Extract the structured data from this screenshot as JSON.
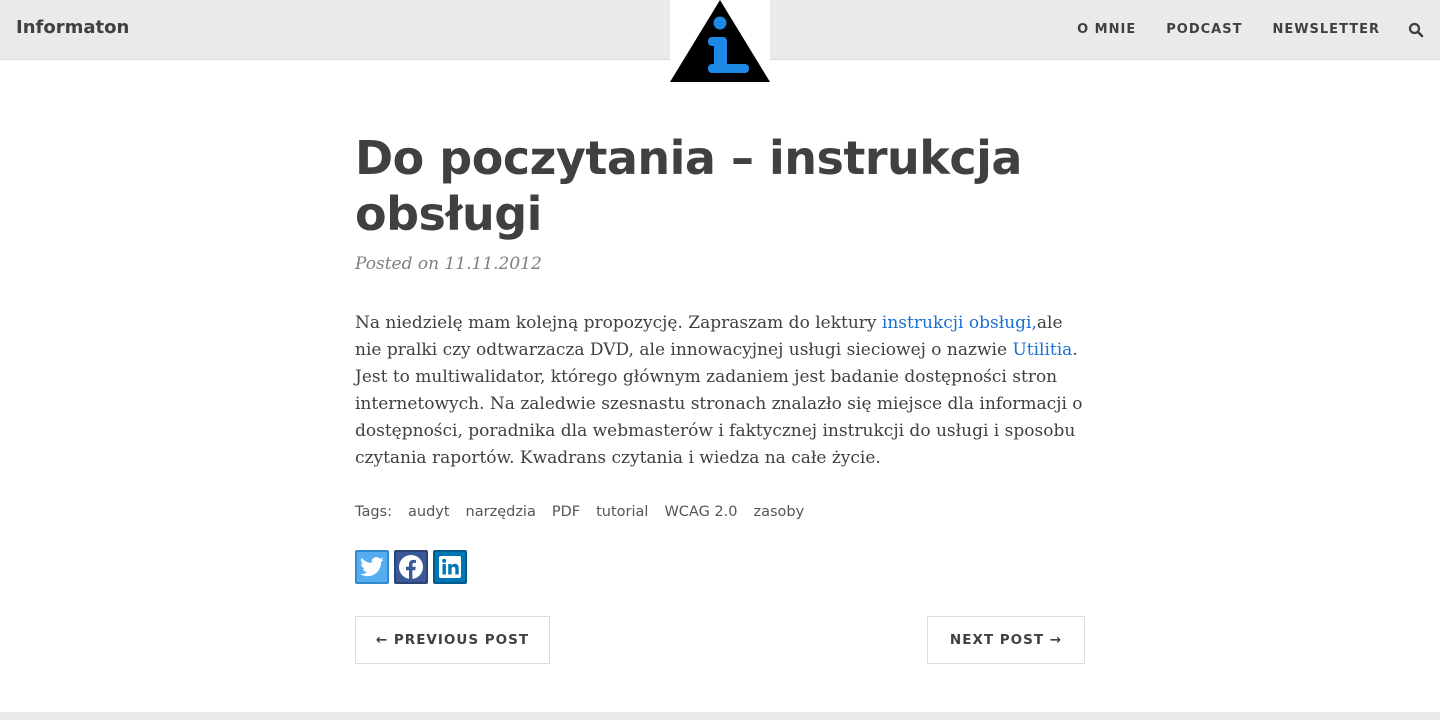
{
  "header": {
    "brand": "Informaton",
    "nav": [
      "O MNIE",
      "PODCAST",
      "NEWSLETTER"
    ],
    "search_icon": "search-icon",
    "logo_icon": "info-triangle-logo"
  },
  "colors": {
    "topbar": "#eaeaea",
    "text": "#404040",
    "link": "#1a6fd1",
    "logo_blue": "#1e88e5"
  },
  "post": {
    "title": "Do poczytania – instrukcja obsługi",
    "meta": "Posted on 11.11.2012",
    "body": {
      "p1": "Na niedzielę mam kolejną propozycję. Zapraszam do lektury ",
      "link1": "instrukcji obsługi,",
      "p2": "ale nie pralki czy odtwarzacza DVD, ale innowacyjnej usługi sieciowej o nazwie ",
      "link2": "Utilitia",
      "p3": ". Jest to multiwalidator, którego głównym zadaniem jest badanie dostępności stron internetowych. Na zaledwie szesnastu stronach znalazło się miejsce dla informacji o dostępności, poradnika dla webmasterów i faktycznej instrukcji do usługi i sposobu czytania raportów. Kwadrans czytania i wiedza na całe życie."
    },
    "tags_label": "Tags:",
    "tags": [
      "audyt",
      "narzędzia",
      "PDF",
      "tutorial",
      "WCAG 2.0",
      "zasoby"
    ],
    "share": [
      "twitter-icon",
      "facebook-icon",
      "linkedin-icon"
    ]
  },
  "pager": {
    "prev": "← PREVIOUS POST",
    "next": "NEXT POST →"
  }
}
